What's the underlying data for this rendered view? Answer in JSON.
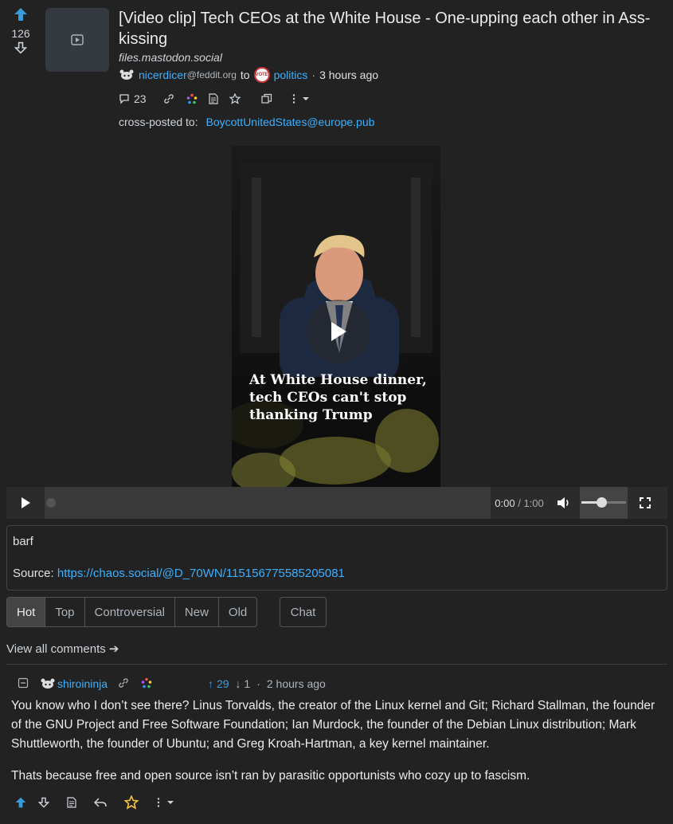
{
  "post": {
    "score": "126",
    "title": "[Video clip] Tech CEOs at the White House - One-upping each other in Ass-kissing",
    "domain": "files.mastodon.social",
    "author": "nicerdicer",
    "author_instance": "@feddit.org",
    "to_label": "to",
    "community": "politics",
    "separator": "·",
    "time": "3 hours ago",
    "comments_count": "23",
    "crosspost_label": "cross-posted to:",
    "crosspost_target": "BoycottUnitedStates@europe.pub"
  },
  "video": {
    "caption": "At White House dinner, tech CEOs can't stop thanking Trump",
    "current_time": "0:00",
    "time_sep": "/",
    "duration": "1:00",
    "volume_level": 0.45
  },
  "body": {
    "text": "barf",
    "source_label": "Source:",
    "source_url": "https://chaos.social/@D_70WN/115156775585205081"
  },
  "sort": {
    "options": [
      "Hot",
      "Top",
      "Controversial",
      "New",
      "Old"
    ],
    "active": "Hot",
    "chat": "Chat"
  },
  "view_all": "View all comments ➔",
  "comment": {
    "user": "shiroininja",
    "upvotes": "29",
    "downvotes": "1",
    "separator": "·",
    "time": "2 hours ago",
    "paragraph1": "You know who I don’t see there? Linus Torvalds, the creator of the Linux kernel and Git; Richard Stallman, the founder of the GNU Project and Free Software Foundation; Ian Murdock, the founder of the Debian Linux distribution; Mark Shuttleworth, the founder of Ubuntu; and Greg Kroah-Hartman, a key kernel maintainer.",
    "paragraph2": "Thats because free and open source isn’t ran by parasitic opportunists who cozy up to fascism."
  },
  "colors": {
    "accent": "#3a9bdc",
    "link": "#3ab0ff",
    "star": "#f0c040",
    "bg": "#222222"
  }
}
